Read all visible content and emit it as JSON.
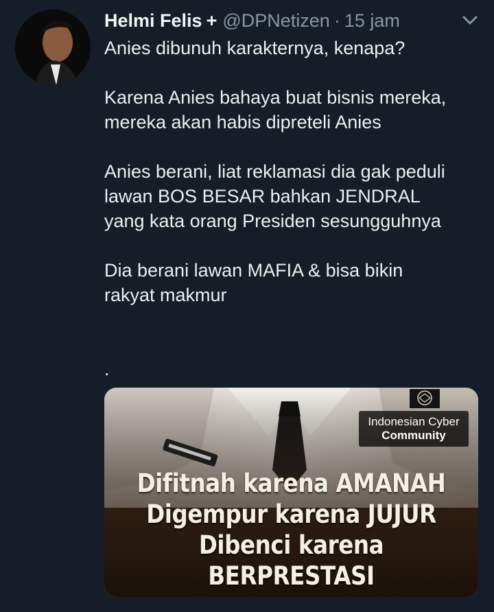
{
  "tweet": {
    "display_name": "Helmi Felis",
    "badge": "+",
    "handle": "@DPNetizen",
    "separator": "·",
    "time": "15 jam",
    "avatar_icon": "profile-photo",
    "menu_icon": "chevron-down-icon",
    "body_lines": [
      "Anies dibunuh karakternya, kenapa?",
      "",
      "Karena Anies bahaya buat bisnis mereka,",
      "mereka akan habis dipreteli Anies",
      "",
      "Anies berani, liat reklamasi dia gak peduli",
      "lawan BOS BESAR bahkan JENDRAL",
      "yang kata orang Presiden sesungguhnya",
      "",
      "Dia berani lawan MAFIA & bisa bikin",
      "rakyat makmur",
      "",
      "",
      "."
    ]
  },
  "media": {
    "watermark_line1": "Indonesian Cyber",
    "watermark_line2": "Community",
    "caption_lines": [
      "Difitnah karena AMANAH",
      "Digempur karena JUJUR",
      "Dibenci karena BERPRESTASI"
    ]
  },
  "colors": {
    "background": "#151d28",
    "text": "#edf0f2",
    "muted": "#8a96a3"
  }
}
